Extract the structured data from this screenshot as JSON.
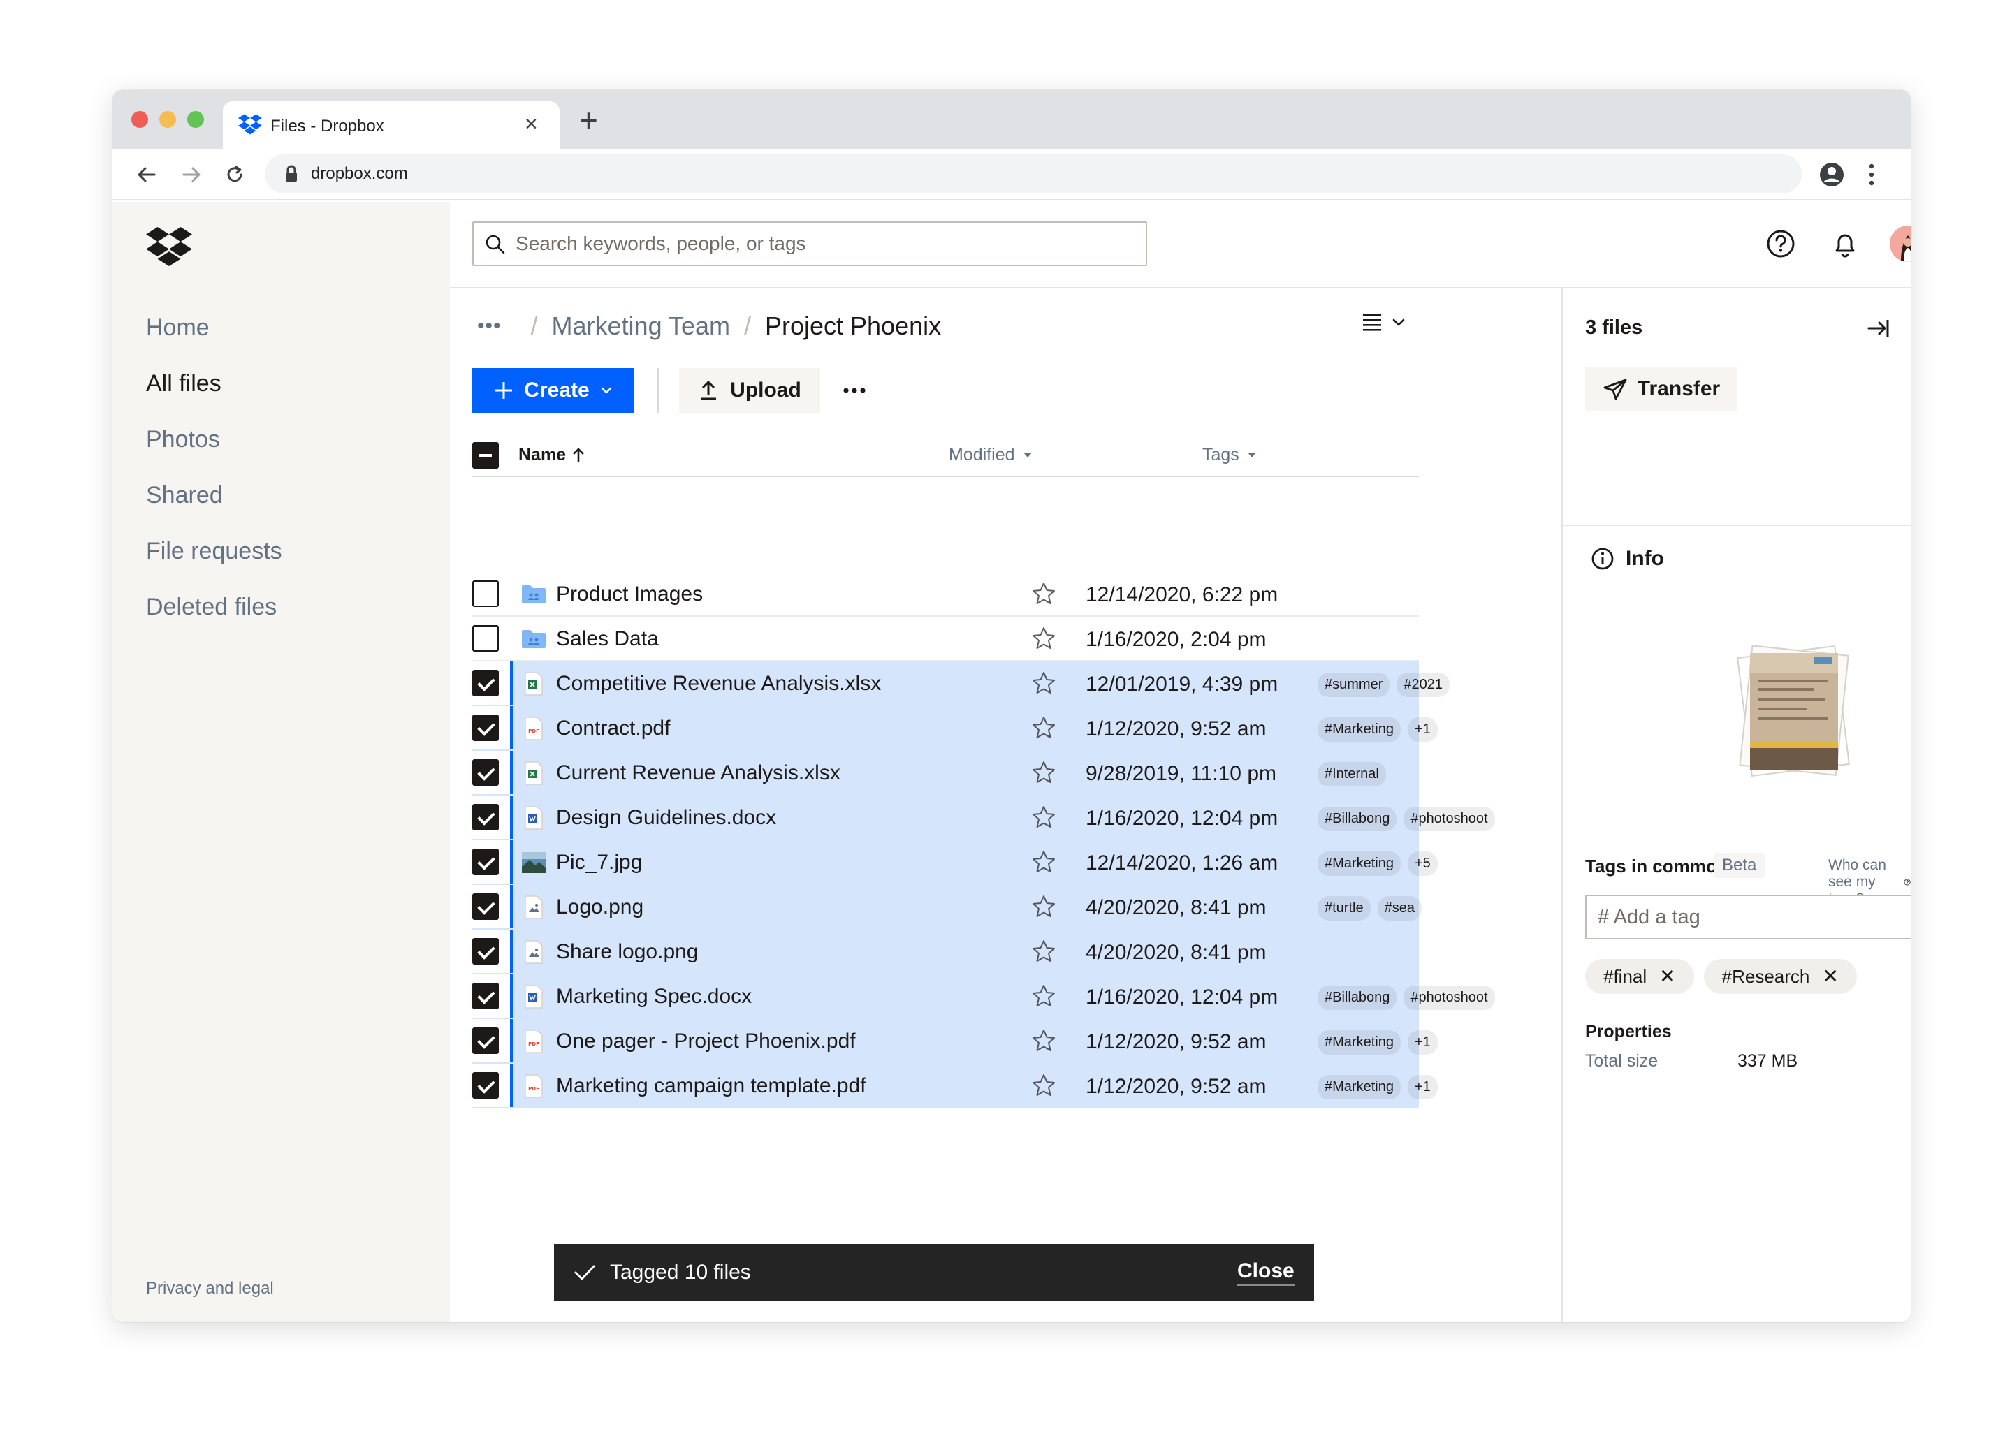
{
  "browser": {
    "tab_title": "Files - Dropbox",
    "url": "dropbox.com"
  },
  "sidebar": {
    "items": [
      {
        "label": "Home"
      },
      {
        "label": "All files"
      },
      {
        "label": "Photos"
      },
      {
        "label": "Shared"
      },
      {
        "label": "File requests"
      },
      {
        "label": "Deleted files"
      }
    ],
    "active": "All files",
    "footer": "Privacy and legal"
  },
  "header": {
    "search_placeholder": "Search keywords, people, or tags"
  },
  "breadcrumb": {
    "ellipsis": "•••",
    "parent": "Marketing Team",
    "current": "Project Phoenix",
    "separator": "/"
  },
  "toolbar": {
    "create_label": "Create",
    "upload_label": "Upload"
  },
  "table": {
    "columns": {
      "name": "Name",
      "modified": "Modified",
      "tags": "Tags"
    },
    "rows": [
      {
        "name": "Product Images",
        "modified": "12/14/2020, 6:22 pm",
        "tags": [],
        "type": "folder",
        "selected": false
      },
      {
        "name": "Sales Data",
        "modified": "1/16/2020, 2:04 pm",
        "tags": [],
        "type": "folder",
        "selected": false
      },
      {
        "name": "Competitive Revenue Analysis.xlsx",
        "modified": "12/01/2019, 4:39 pm",
        "tags": [
          "#summer",
          "#2021"
        ],
        "type": "xlsx",
        "selected": true
      },
      {
        "name": "Contract.pdf",
        "modified": "1/12/2020, 9:52 am",
        "tags": [
          "#Marketing",
          "+1"
        ],
        "type": "pdf",
        "selected": true
      },
      {
        "name": "Current Revenue Analysis.xlsx",
        "modified": "9/28/2019, 11:10 pm",
        "tags": [
          "#Internal"
        ],
        "type": "xlsx",
        "selected": true
      },
      {
        "name": "Design Guidelines.docx",
        "modified": "1/16/2020, 12:04 pm",
        "tags": [
          "#Billabong",
          "#photoshoot"
        ],
        "type": "docx",
        "selected": true
      },
      {
        "name": "Pic_7.jpg",
        "modified": "12/14/2020, 1:26 am",
        "tags": [
          "#Marketing",
          "+5"
        ],
        "type": "jpg",
        "selected": true
      },
      {
        "name": "Logo.png",
        "modified": "4/20/2020, 8:41 pm",
        "tags": [
          "#turtle",
          "#sea"
        ],
        "type": "png",
        "selected": true
      },
      {
        "name": "Share logo.png",
        "modified": "4/20/2020, 8:41 pm",
        "tags": [],
        "type": "png",
        "selected": true
      },
      {
        "name": "Marketing Spec.docx",
        "modified": "1/16/2020, 12:04 pm",
        "tags": [
          "#Billabong",
          "#photoshoot"
        ],
        "type": "docx",
        "selected": true
      },
      {
        "name": "One pager - Project Phoenix.pdf",
        "modified": "1/12/2020, 9:52 am",
        "tags": [
          "#Marketing",
          "+1"
        ],
        "type": "pdf",
        "selected": true
      },
      {
        "name": "Marketing campaign template.pdf",
        "modified": "1/12/2020, 9:52 am",
        "tags": [
          "#Marketing",
          "+1"
        ],
        "type": "pdf",
        "selected": true
      }
    ]
  },
  "details": {
    "count_label": "3 files",
    "transfer_label": "Transfer",
    "info_label": "Info",
    "tags_common_label": "Tags in common",
    "beta_label": "Beta",
    "who_label": "Who can see my tags?",
    "add_tag_placeholder": "# Add a tag",
    "chips": [
      "#final",
      "#Research"
    ],
    "properties_label": "Properties",
    "total_size_label": "Total size",
    "total_size_value": "337 MB"
  },
  "snackbar": {
    "message": "Tagged 10 files",
    "close_label": "Close"
  },
  "colors": {
    "accent": "#0061fe",
    "selection": "#d5e5fc",
    "sidebar_bg": "#f7f5f2",
    "snackbar_bg": "#242424"
  },
  "icons": {
    "search": "search-icon",
    "help": "help-icon",
    "bell": "bell-icon",
    "apps": "apps-grid-icon",
    "star": "star-icon",
    "info": "info-icon",
    "transfer": "paper-plane-icon"
  }
}
